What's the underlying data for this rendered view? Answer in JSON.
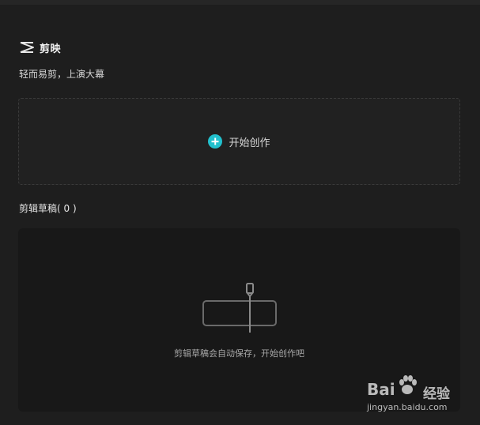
{
  "app": {
    "name": "剪映",
    "slogan": "轻而易剪，上演大幕",
    "logo_icon": "capcut-logo-icon"
  },
  "create": {
    "label": "开始创作",
    "icon": "plus-circle-icon",
    "accent_color": "#22c0cd"
  },
  "drafts": {
    "title": "剪辑草稿( 0 )",
    "empty_text": "剪辑草稿会自动保存，开始创作吧",
    "empty_icon": "empty-draft-clip-icon"
  },
  "watermark": {
    "brand": "Bai",
    "brand_cn": "经验",
    "url": "jingyan.baidu.com"
  }
}
